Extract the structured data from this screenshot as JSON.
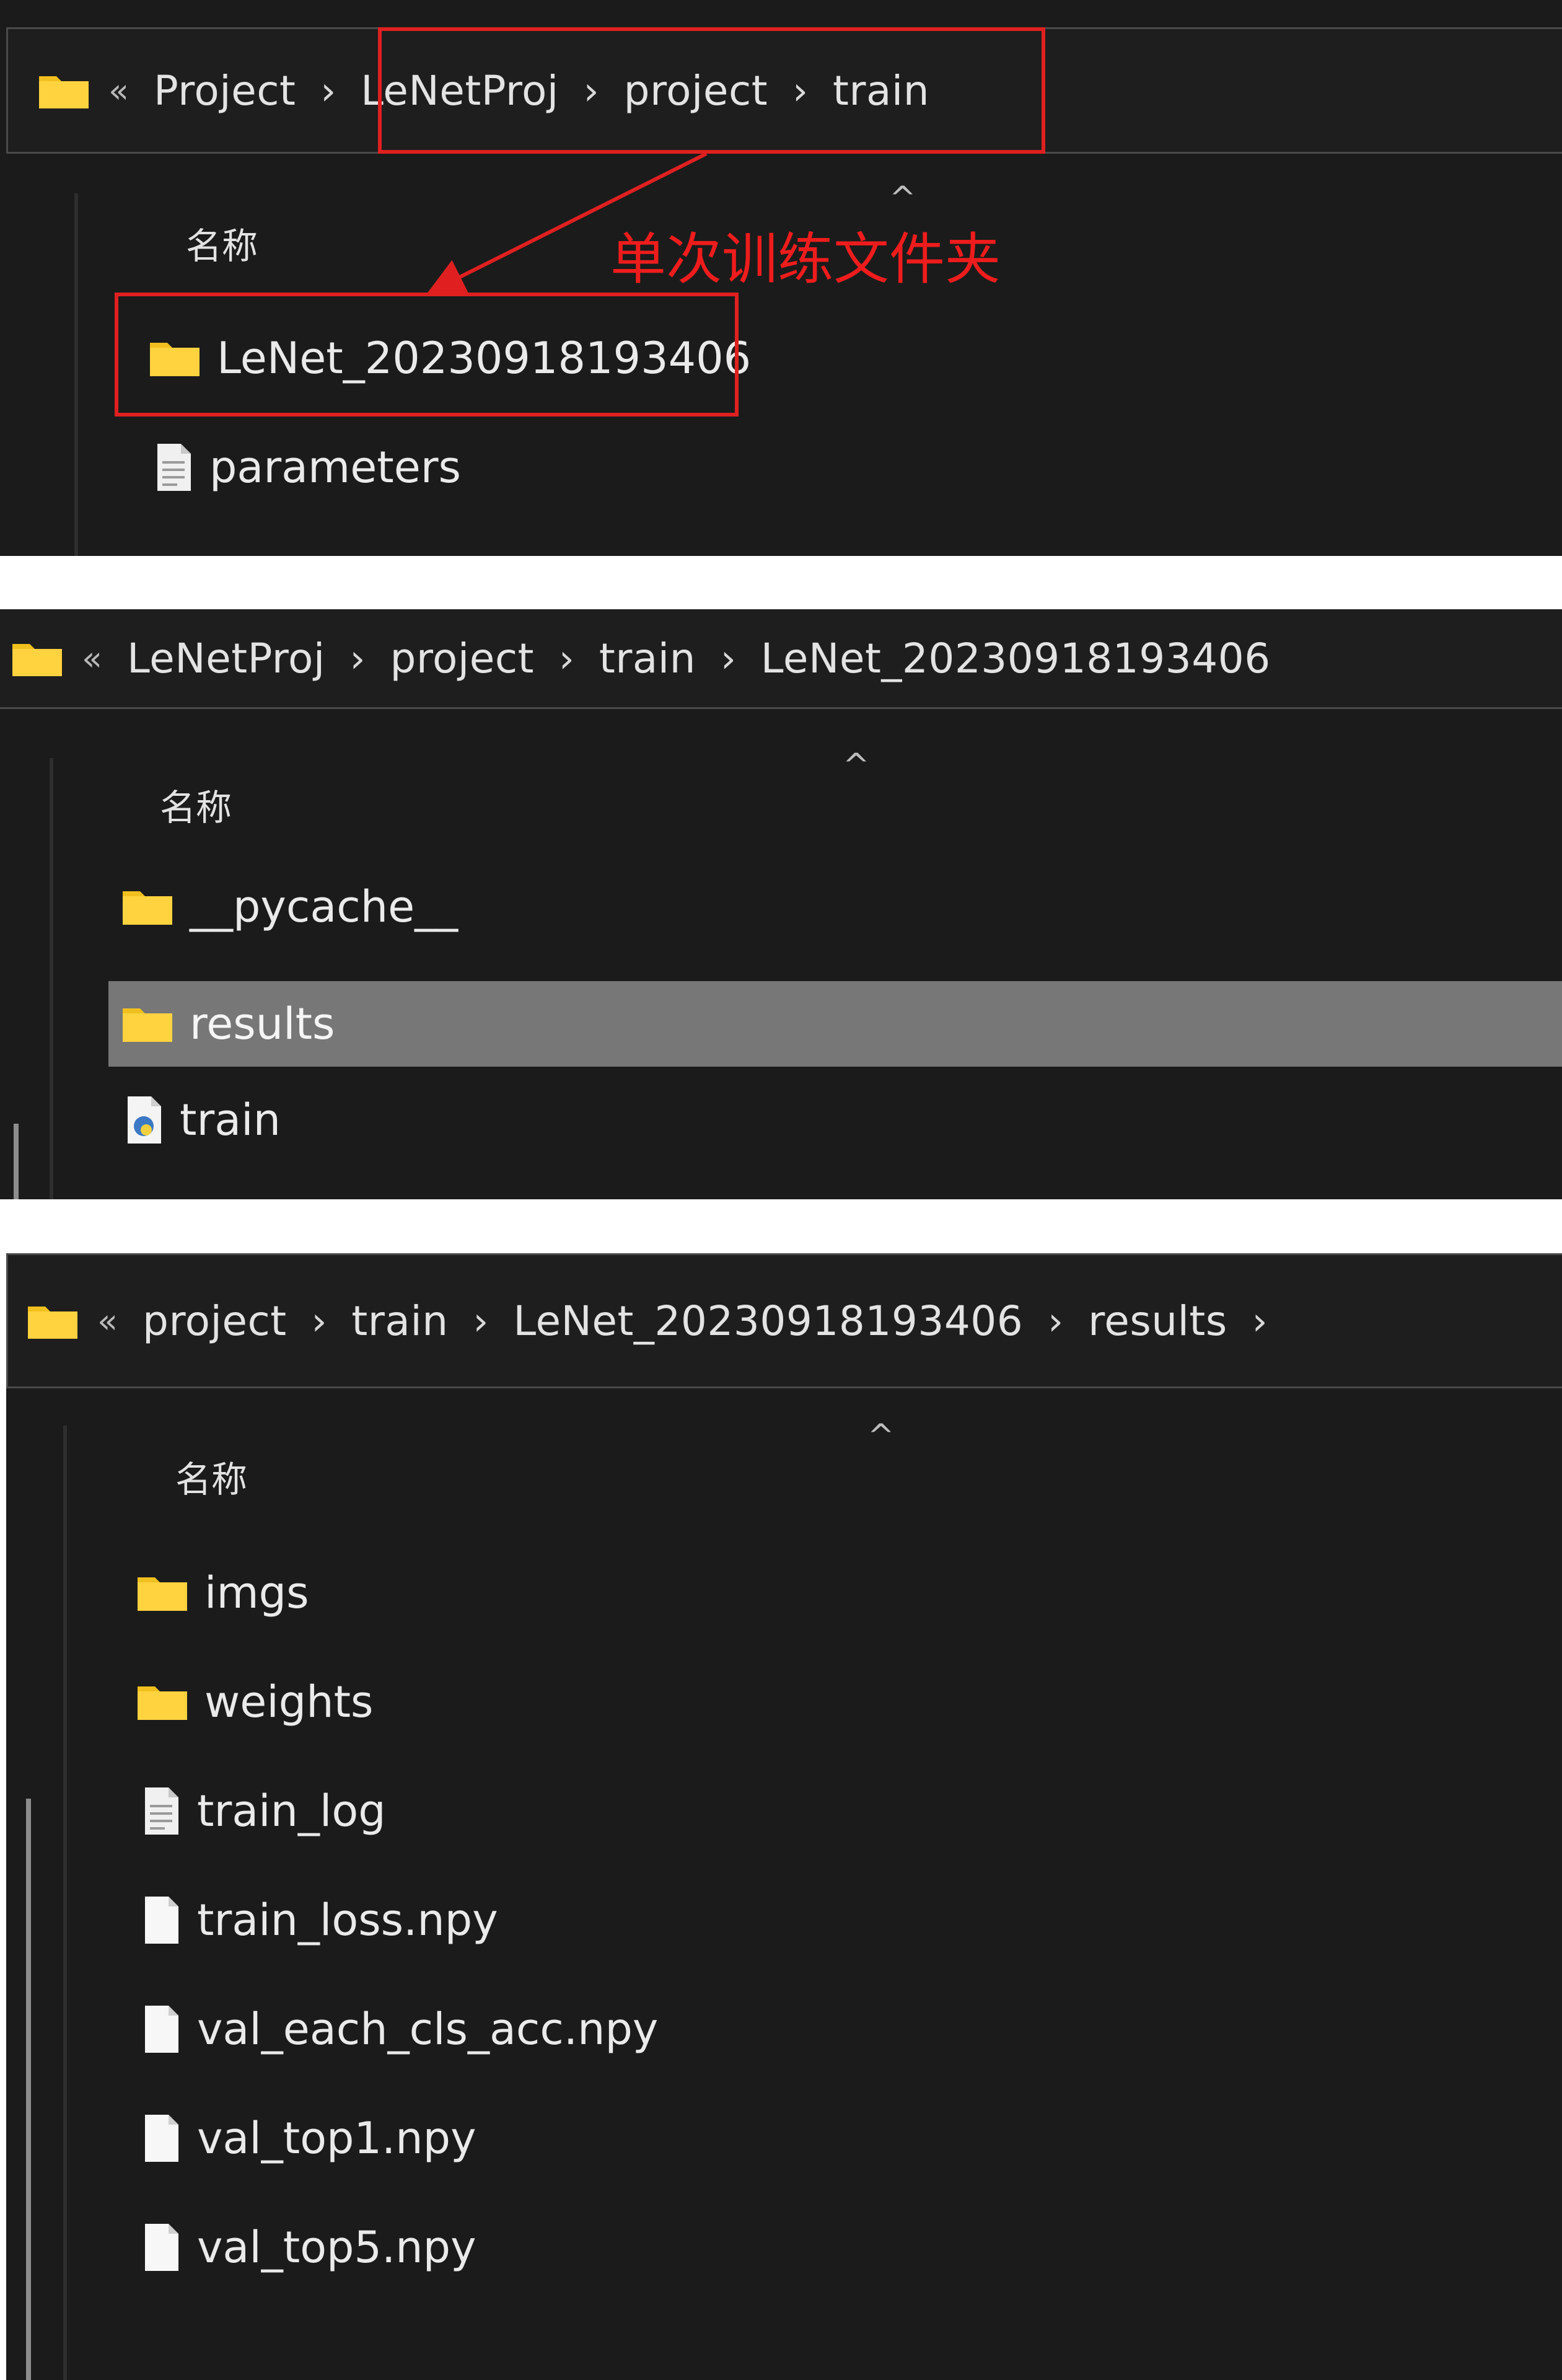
{
  "panels": [
    {
      "breadcrumb": {
        "overflow": "«",
        "items": [
          "Project",
          "LeNetProj",
          "project",
          "train"
        ]
      },
      "column_header": "名称",
      "rows": [
        {
          "name": "LeNet_20230918193406",
          "icon": "folder-icon",
          "selected": false
        },
        {
          "name": "parameters",
          "icon": "text-file-icon",
          "selected": false
        }
      ],
      "annotation": "单次训练文件夹"
    },
    {
      "breadcrumb": {
        "overflow": "«",
        "items": [
          "LeNetProj",
          "project",
          "train",
          "LeNet_20230918193406"
        ]
      },
      "column_header": "名称",
      "rows": [
        {
          "name": "__pycache__",
          "icon": "folder-icon",
          "selected": false
        },
        {
          "name": "results",
          "icon": "folder-icon",
          "selected": true
        },
        {
          "name": "train",
          "icon": "python-file-icon",
          "selected": false
        }
      ]
    },
    {
      "breadcrumb": {
        "overflow": "«",
        "items": [
          "project",
          "train",
          "LeNet_20230918193406",
          "results"
        ]
      },
      "column_header": "名称",
      "rows": [
        {
          "name": "imgs",
          "icon": "folder-icon",
          "selected": false
        },
        {
          "name": "weights",
          "icon": "folder-icon",
          "selected": false
        },
        {
          "name": "train_log",
          "icon": "text-file-icon",
          "selected": false
        },
        {
          "name": "train_loss.npy",
          "icon": "file-icon",
          "selected": false
        },
        {
          "name": "val_each_cls_acc.npy",
          "icon": "file-icon",
          "selected": false
        },
        {
          "name": "val_top1.npy",
          "icon": "file-icon",
          "selected": false
        },
        {
          "name": "val_top5.npy",
          "icon": "file-icon",
          "selected": false
        }
      ]
    }
  ],
  "colors": {
    "background": "#1b1b1b",
    "text": "#eaeaea",
    "annotation_red": "#e02020",
    "folder_yellow": "#f5c518",
    "selection": "#777777"
  }
}
